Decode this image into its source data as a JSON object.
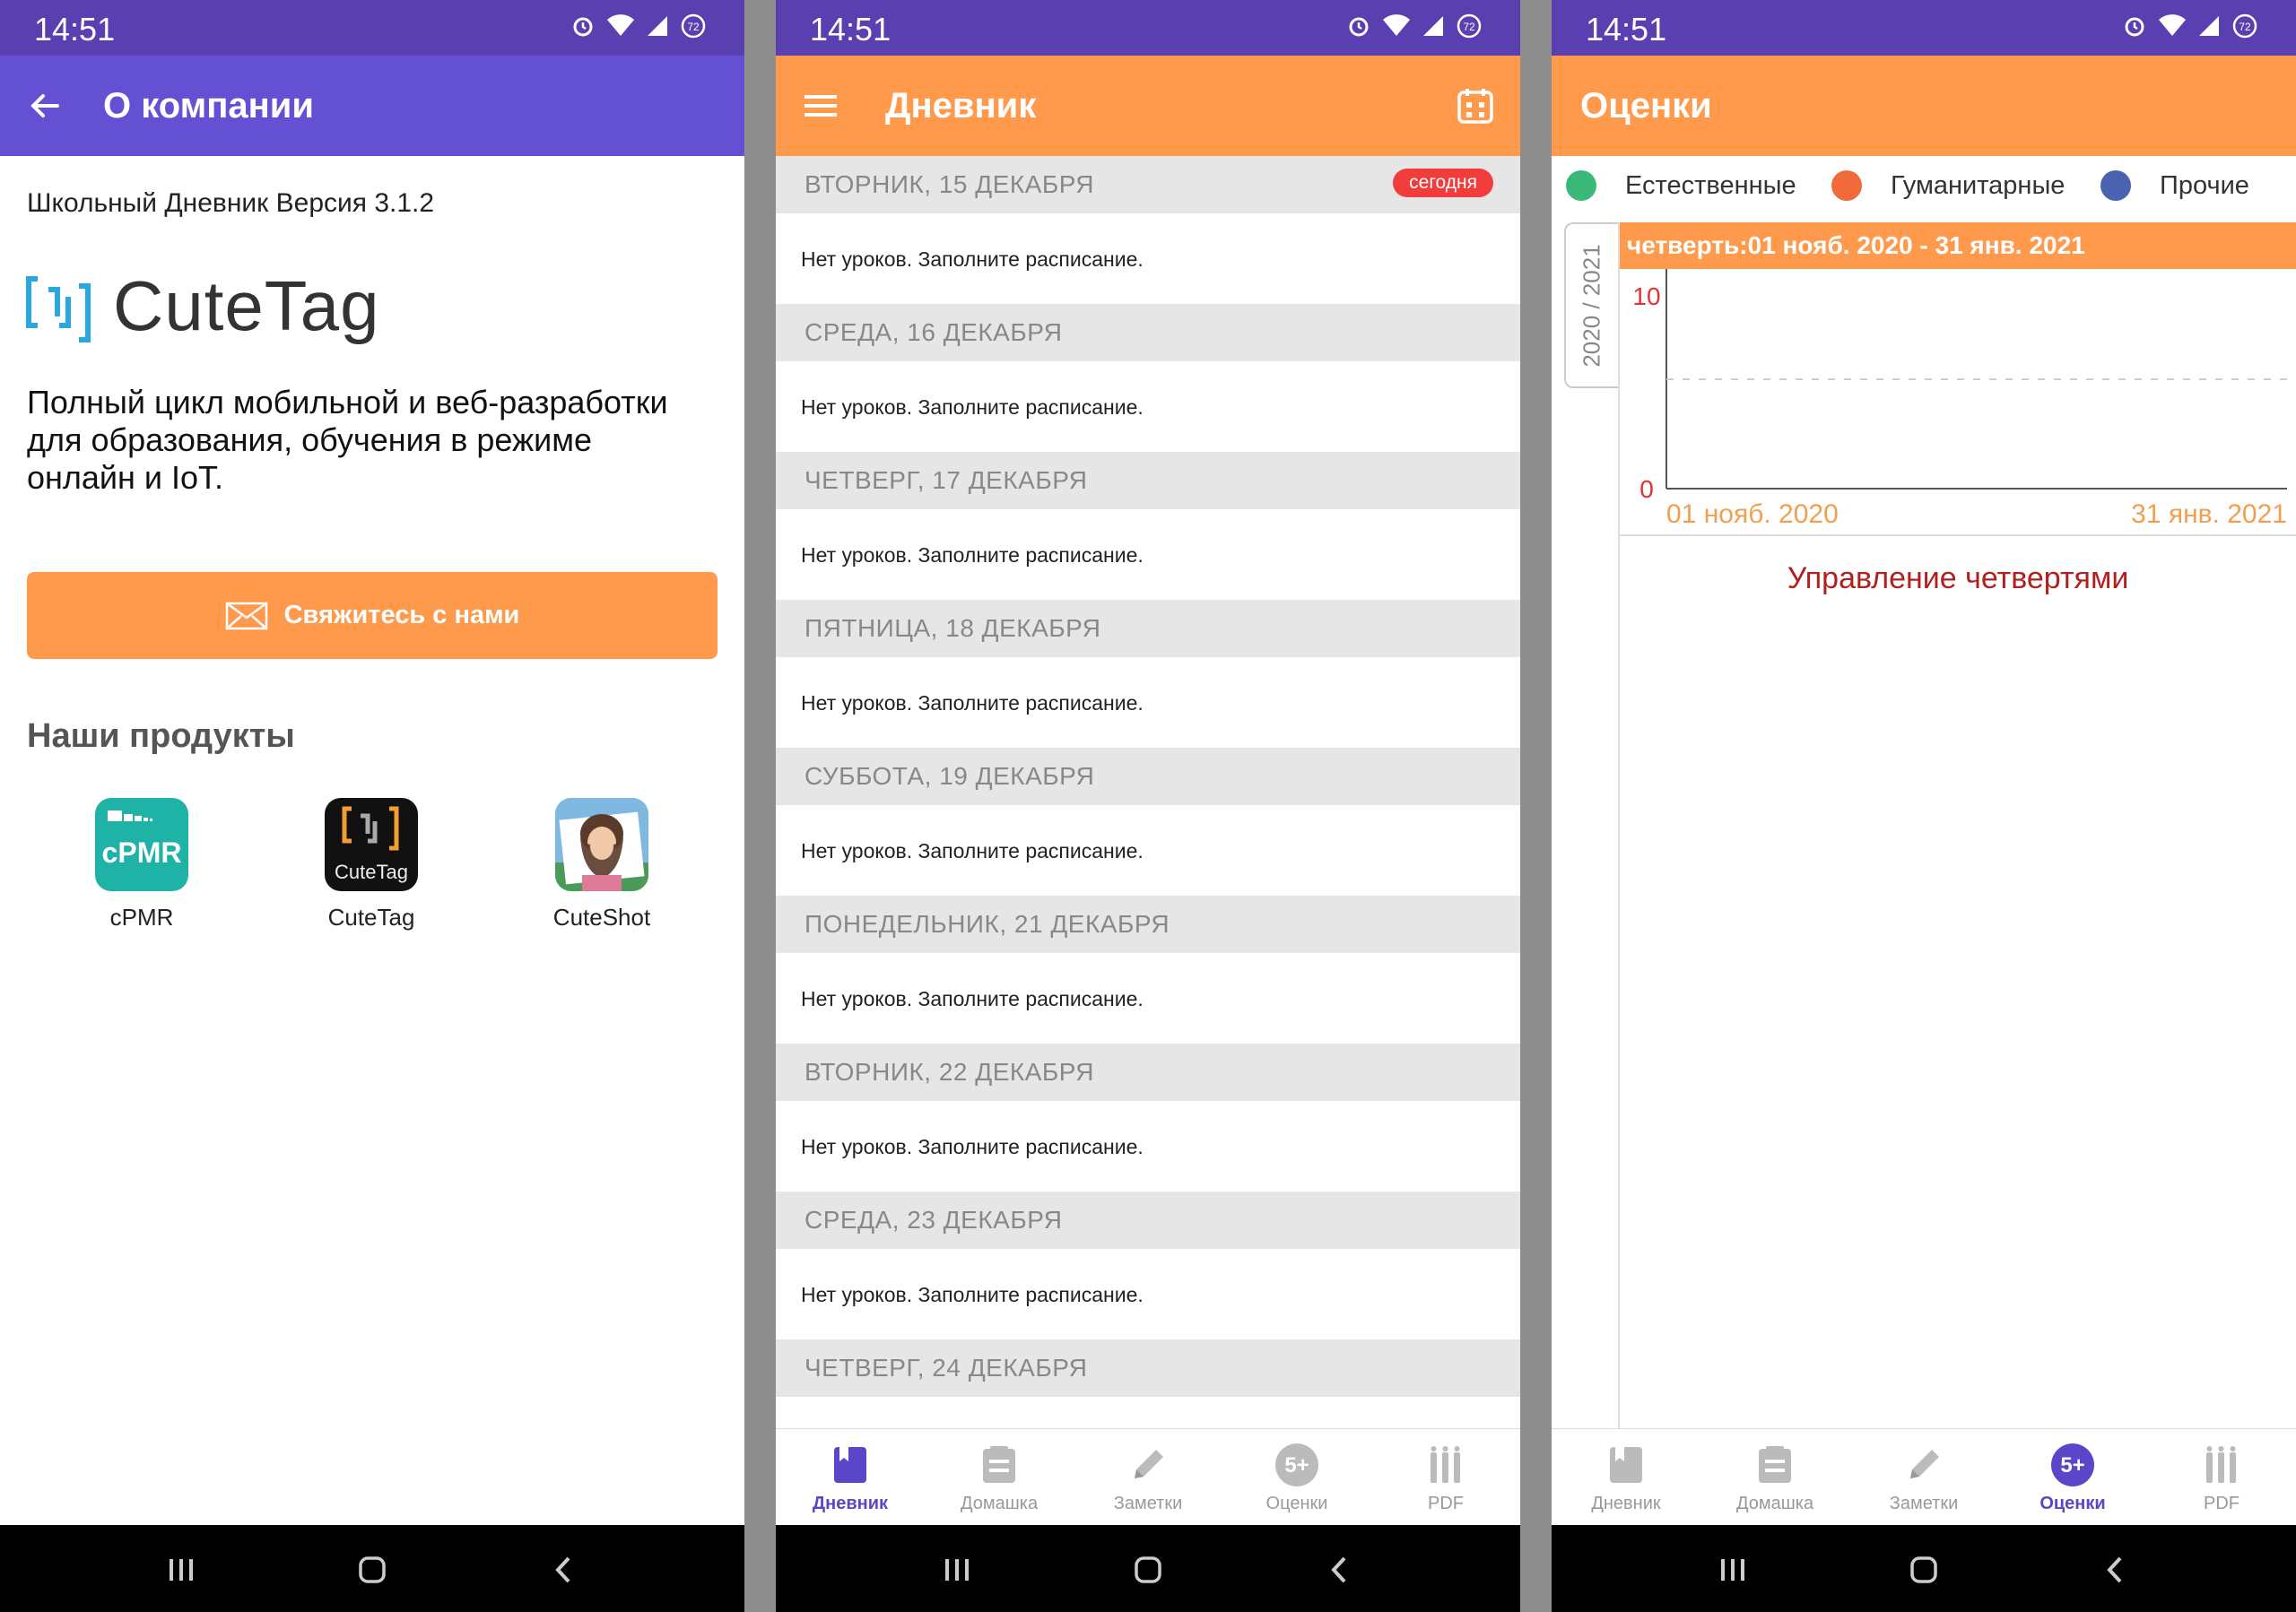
{
  "colors": {
    "status_bar": "#5a3fb0",
    "appbar_purple": "#6450d2",
    "appbar_orange": "#ff9a4d",
    "accent_orange": "#ff9a4d",
    "today_badge": "#f23b3b",
    "bottom_active": "#5a46c9",
    "link_red": "#b21f1f"
  },
  "status_bar": {
    "time": "14:51",
    "icons": [
      "alarm-icon",
      "wifi-icon",
      "signal-icon",
      "battery-icon"
    ],
    "battery": "72"
  },
  "screens": [
    {
      "appbar": {
        "title": "О компании",
        "nav_icon": "back-arrow-icon"
      },
      "version": "Школьный Дневник Версия 3.1.2",
      "logo_text": "CuteTag",
      "description": "Полный цикл мобильной и веб-разработки для образования, обучения в режиме онлайн и IoT.",
      "contact_button": {
        "label": "Свяжитесь с нами",
        "icon": "mail-icon"
      },
      "products_heading": "Наши продукты",
      "products": [
        {
          "label": "cPMR",
          "icon_text": "cPMR"
        },
        {
          "label": "CuteTag",
          "icon_text": "CuteTag"
        },
        {
          "label": "CuteShot"
        }
      ]
    },
    {
      "appbar": {
        "title": "Дневник",
        "nav_icon": "menu-icon",
        "action_icon": "calendar-icon"
      },
      "today_badge": "сегодня",
      "days": [
        {
          "day": "ВТОРНИК, 15 ДЕКАБРЯ",
          "message": "Нет уроков. Заполните расписание.",
          "today": true
        },
        {
          "day": "СРЕДА, 16 ДЕКАБРЯ",
          "message": "Нет уроков. Заполните расписание."
        },
        {
          "day": "ЧЕТВЕРГ, 17 ДЕКАБРЯ",
          "message": "Нет уроков. Заполните расписание."
        },
        {
          "day": "ПЯТНИЦА, 18 ДЕКАБРЯ",
          "message": "Нет уроков. Заполните расписание."
        },
        {
          "day": "СУББОТА, 19 ДЕКАБРЯ",
          "message": "Нет уроков. Заполните расписание."
        },
        {
          "day": "ПОНЕДЕЛЬНИК, 21 ДЕКАБРЯ",
          "message": "Нет уроков. Заполните расписание."
        },
        {
          "day": "ВТОРНИК, 22 ДЕКАБРЯ",
          "message": "Нет уроков. Заполните расписание."
        },
        {
          "day": "СРЕДА, 23 ДЕКАБРЯ",
          "message": "Нет уроков. Заполните расписание."
        },
        {
          "day": "ЧЕТВЕРГ, 24 ДЕКАБРЯ",
          "message": ""
        }
      ],
      "bottom_nav": [
        {
          "label": "Дневник",
          "icon": "book-icon",
          "active": true
        },
        {
          "label": "Домашка",
          "icon": "homework-icon"
        },
        {
          "label": "Заметки",
          "icon": "pencil-icon"
        },
        {
          "label": "Оценки",
          "icon": "grade-icon",
          "icon_text": "5+"
        },
        {
          "label": "PDF",
          "icon": "pdf-icon"
        }
      ]
    },
    {
      "appbar": {
        "title": "Оценки"
      },
      "legend": [
        {
          "label": "Естественные",
          "color": "#3cb878"
        },
        {
          "label": "Гуманитарные",
          "color": "#f06a3a"
        },
        {
          "label": "Прочие",
          "color": "#4a62b0"
        }
      ],
      "school_year": "2020 / 2021",
      "quarter": "четверть:01 нояб. 2020 - 31 янв. 2021",
      "manage_link": "Управление четвертями",
      "bottom_nav": [
        {
          "label": "Дневник",
          "icon": "book-icon"
        },
        {
          "label": "Домашка",
          "icon": "homework-icon"
        },
        {
          "label": "Заметки",
          "icon": "pencil-icon"
        },
        {
          "label": "Оценки",
          "icon": "grade-icon",
          "icon_text": "5+",
          "active": true
        },
        {
          "label": "PDF",
          "icon": "pdf-icon"
        }
      ]
    }
  ],
  "chart_data": {
    "type": "line",
    "x": [
      "01 нояб. 2020",
      "31 янв. 2021"
    ],
    "series": [],
    "xlabel": "",
    "ylabel": "",
    "ylim": [
      0,
      10
    ],
    "y_ticks": [
      "10",
      "0"
    ],
    "x_ticks": [
      "01 нояб. 2020",
      "31 янв. 2021"
    ],
    "grid": "dashed reference line"
  }
}
